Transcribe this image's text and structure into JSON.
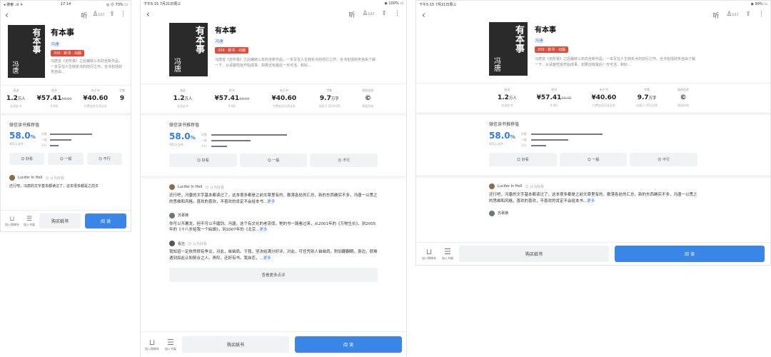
{
  "frame1": {
    "status_left": "◂ 搜索 .ııl ✈",
    "status_mid": "17:14",
    "status_right": "◎ ⓪ 73% ▭",
    "stats_v3": "¥40.60",
    "stats_s3": "付费会员可读全本",
    "stats_h4": "9",
    "review_text": "还行吧，冯唐的文字基本都读过了，这本很多都是之前文"
  },
  "frame2": {
    "status_left": "下午5:15  7月21日周三",
    "status_right": "◉ 100% ▭"
  },
  "frame3": {
    "status_left": "下午5:15  7月21日周三",
    "status_right": "◉ 99% ▭"
  },
  "nav": {
    "back": "‹",
    "listen": "听",
    "user_badge": "1/17",
    "share": "⇪",
    "menu": "⋮"
  },
  "book": {
    "cover_title": "有本事",
    "cover_author": "冯唐",
    "title": "有本事",
    "author": "冯唐",
    "badge": "200 · 新书 · 出版",
    "intro": "冯唐曾《无所畏》之后辗转三年的全新作品，一本写在人生转折点的前行之作。全书包括财务自由了解一下、从请客吃饭开始成事、如果还有最后一天可活、和好...",
    "intro_short": "冯唐曾《无所畏》之后辗转三年的全新作品，一本写在人生转折点的前行之作。全书包括财务自由..."
  },
  "stats": [
    {
      "h": "阅读",
      "v": "1.2",
      "u": "万人",
      "s": "在读此书"
    },
    {
      "h": "纸书",
      "v": "¥57.41",
      "old": "59.00",
      "s": "9.8折"
    },
    {
      "h": "电子书",
      "v": "¥40.60",
      "s": "付费会员可读全本"
    },
    {
      "h": "字数",
      "v": "9.7",
      "u": "万字",
      "s": "出版于 2021/06"
    },
    {
      "h": "版权信息",
      "v": "©",
      "s": "版权所有"
    }
  ],
  "rec": {
    "heading": "微信读书推荐值",
    "percent": "58.0",
    "unit": "%",
    "count": "405人点评 ›",
    "bars": [
      {
        "label": "好看",
        "value": 0.58
      },
      {
        "label": "一般",
        "value": 0.3
      },
      {
        "label": "不行",
        "value": 0.12
      }
    ],
    "btn_good": "☺ 好看",
    "btn_ok": "☺ 一般",
    "btn_bad": "☹ 不行"
  },
  "reviews": [
    {
      "user": "Lucifer In Hell",
      "tag": "☺ 认为好看",
      "text": "还行吧，冯唐的文字基本都读过了，这本很多都是之前文章里有的，散落各处的汇总，新的东西确实不多，冯唐一以贯之的思维和风格，喜欢的喜欢，不喜欢的肯定不会给本书...",
      "more": "更多"
    },
    {
      "user": "苏慕摘",
      "tag": "",
      "text": "你可以不屠龙，但不可以不磨剑。冯唐，这个有文化的老流氓，牠的书一路看过来，从2001年的《万物生长》，到2005年的《十八岁给我一个姑娘》，到2007年的《北京...",
      "more": "更多"
    },
    {
      "user": "看还",
      "tag": "☺ 认为好看",
      "text": "我知道一定依然很有争议，对此，耸耸肩。于我，坚决给满分好评，对此，可任凭别人耸耸肩，附加翻翻眼。身边，很难遇到如此认知契合之人。再叹，还好有书。我自恋，...",
      "more": "更多"
    }
  ],
  "more_reviews": "查看更多点评",
  "bottom": {
    "shelf_label": "加入购物车",
    "cart_label": "加入书架",
    "buy": "购买纸书",
    "read": "阅 读"
  }
}
